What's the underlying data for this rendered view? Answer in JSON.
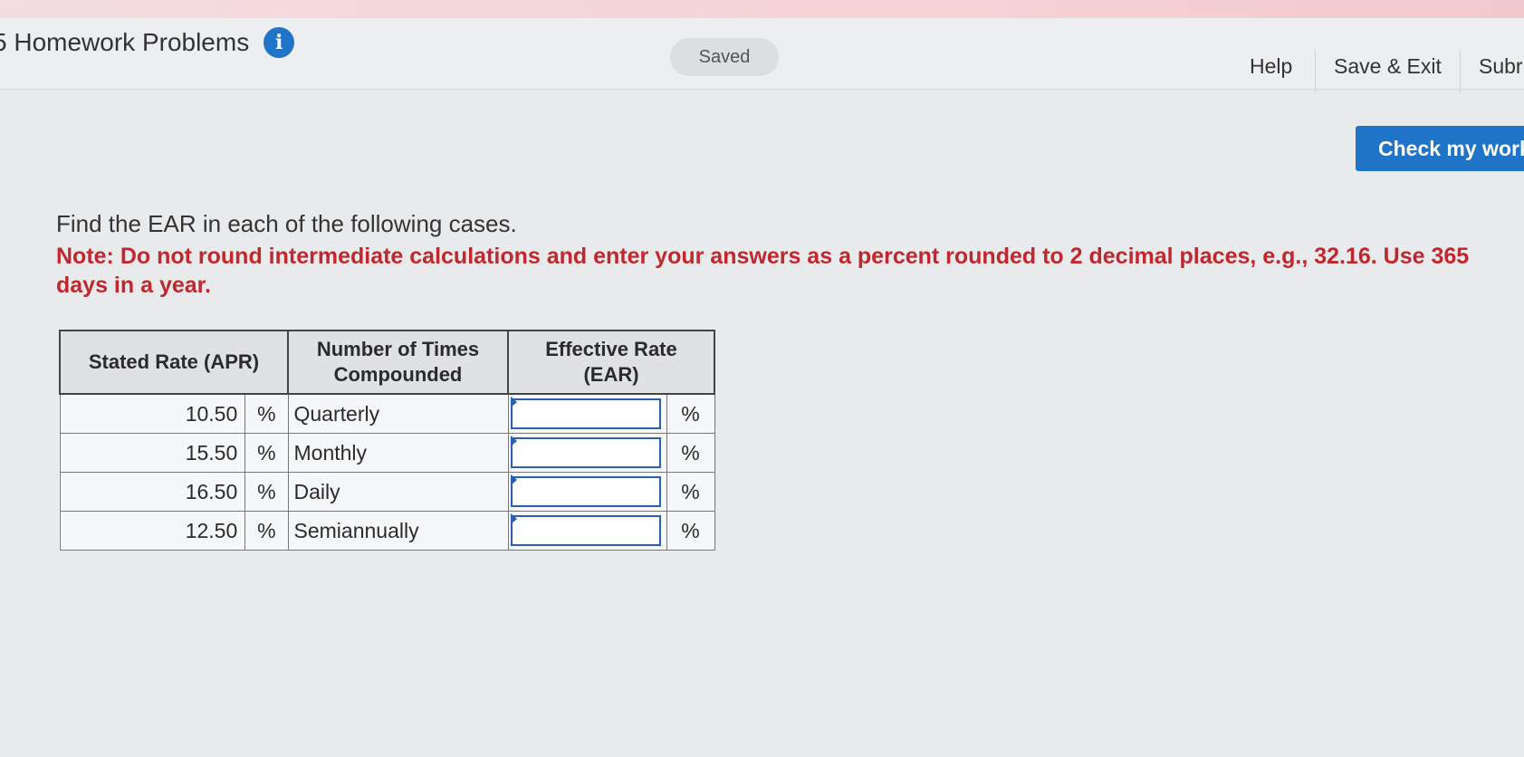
{
  "header": {
    "title": "5 Homework Problems",
    "info_icon": "i",
    "saved_label": "Saved",
    "nav": {
      "help": "Help",
      "save_exit": "Save & Exit",
      "submit": "Subr"
    }
  },
  "check_button": "Check my work",
  "question": {
    "text": "Find the EAR in each of the following cases.",
    "note": "Note: Do not round intermediate calculations and enter your answers as a percent rounded to 2 decimal places, e.g., 32.16. Use 365 days in a year."
  },
  "table": {
    "headers": {
      "apr": "Stated Rate (APR)",
      "times": "Number of Times Compounded",
      "ear": "Effective Rate (EAR)"
    },
    "rows": [
      {
        "rate": "10.50",
        "unit": "%",
        "compounding": "Quarterly",
        "ear_value": "",
        "ear_unit": "%"
      },
      {
        "rate": "15.50",
        "unit": "%",
        "compounding": "Monthly",
        "ear_value": "",
        "ear_unit": "%"
      },
      {
        "rate": "16.50",
        "unit": "%",
        "compounding": "Daily",
        "ear_value": "",
        "ear_unit": "%"
      },
      {
        "rate": "12.50",
        "unit": "%",
        "compounding": "Semiannually",
        "ear_value": "",
        "ear_unit": "%"
      }
    ]
  },
  "colors": {
    "accent": "#1f74c7",
    "note_red": "#c1272d"
  }
}
